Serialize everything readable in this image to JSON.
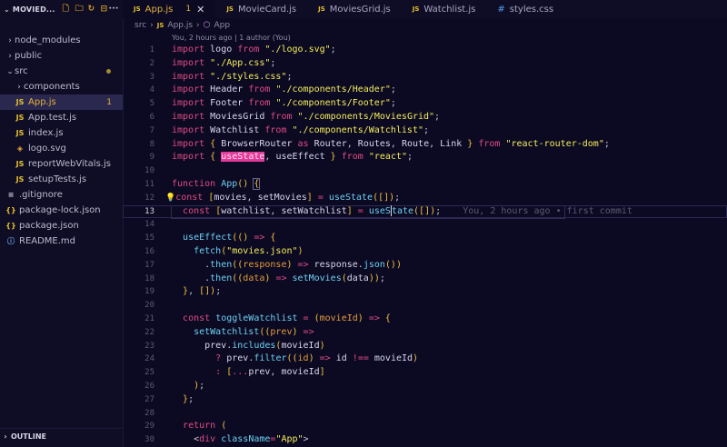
{
  "explorer": {
    "title": "MOVIED...",
    "items": [
      {
        "label": "node_modules",
        "kind": "folder",
        "indent": 0,
        "open": false
      },
      {
        "label": "public",
        "kind": "folder",
        "indent": 0,
        "open": false
      },
      {
        "label": "src",
        "kind": "folder",
        "indent": 0,
        "open": true
      },
      {
        "label": "components",
        "kind": "folder",
        "indent": 1,
        "open": false
      },
      {
        "label": "App.js",
        "kind": "js",
        "indent": 1,
        "badge": "1"
      },
      {
        "label": "App.test.js",
        "kind": "js",
        "indent": 1
      },
      {
        "label": "index.js",
        "kind": "js",
        "indent": 1
      },
      {
        "label": "logo.svg",
        "kind": "svg",
        "indent": 1
      },
      {
        "label": "reportWebVitals.js",
        "kind": "js",
        "indent": 1
      },
      {
        "label": "setupTests.js",
        "kind": "js",
        "indent": 1
      },
      {
        "label": ".gitignore",
        "kind": "git",
        "indent": 0
      },
      {
        "label": "package-lock.json",
        "kind": "json",
        "indent": 0
      },
      {
        "label": "package.json",
        "kind": "json",
        "indent": 0
      },
      {
        "label": "README.md",
        "kind": "info",
        "indent": 0
      }
    ],
    "outline_label": "OUTLINE"
  },
  "tabs": [
    {
      "label": "App.js",
      "icon": "JS",
      "active": true,
      "badge": "1"
    },
    {
      "label": "MovieCard.js",
      "icon": "JS"
    },
    {
      "label": "MoviesGrid.js",
      "icon": "JS"
    },
    {
      "label": "Watchlist.js",
      "icon": "JS"
    },
    {
      "label": "styles.css",
      "icon": "#"
    }
  ],
  "breadcrumb": {
    "folder": "src",
    "file": "App.js",
    "file_icon": "JS",
    "symbol": "App"
  },
  "blame_header": "You, 2 hours ago | 1 author (You)",
  "inline_blame": "You, 2 hours ago • first commit",
  "current_line": 13,
  "line_numbers": [
    "1",
    "2",
    "3",
    "4",
    "5",
    "6",
    "7",
    "8",
    "9",
    "10",
    "11",
    "12",
    "13",
    "14",
    "15",
    "16",
    "17",
    "18",
    "19",
    "20",
    "21",
    "22",
    "23",
    "24",
    "25",
    "26",
    "27",
    "28",
    "29",
    "30"
  ],
  "colors": {
    "accent": "#e5b03a",
    "keyword": "#e04a86",
    "string": "#f3ec5b",
    "function": "#6cd0f3",
    "background": "#0c0a22"
  }
}
